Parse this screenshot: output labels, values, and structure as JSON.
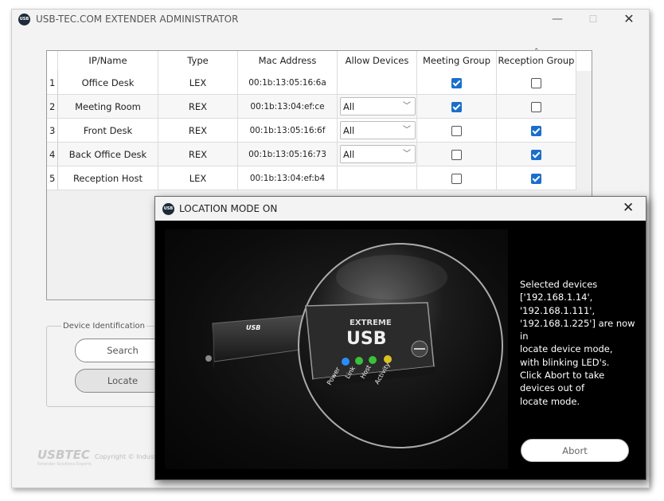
{
  "window": {
    "logo_text": "USB",
    "title": "USB-TEC.COM EXTENDER ADMINISTRATOR",
    "minimize": "—",
    "maximize": "☐",
    "close": "✕"
  },
  "table": {
    "columns": [
      "IP/Name",
      "Type",
      "Mac Address",
      "Allow Devices",
      "Meeting Group",
      "Reception Group"
    ],
    "rows": [
      {
        "num": "1",
        "name": "Office Desk",
        "type": "LEX",
        "mac": "00:1b:13:05:16:6a",
        "allow": "",
        "meeting": true,
        "reception": false
      },
      {
        "num": "2",
        "name": "Meeting Room",
        "type": "REX",
        "mac": "00:1b:13:04:ef:ce",
        "allow": "All",
        "meeting": true,
        "reception": false
      },
      {
        "num": "3",
        "name": "Front Desk",
        "type": "REX",
        "mac": "00:1b:13:05:16:6f",
        "allow": "All",
        "meeting": false,
        "reception": true
      },
      {
        "num": "4",
        "name": "Back Office Desk",
        "type": "REX",
        "mac": "00:1b:13:05:16:73",
        "allow": "All",
        "meeting": false,
        "reception": true
      },
      {
        "num": "5",
        "name": "Reception Host",
        "type": "LEX",
        "mac": "00:1b:13:04:ef:b4",
        "allow": "",
        "meeting": false,
        "reception": true
      }
    ]
  },
  "device_identification": {
    "legend": "Device Identification",
    "search_label": "Search",
    "locate_label": "Locate"
  },
  "footer": {
    "logo": "USBTEC",
    "tagline": "Extender Solutions Experts",
    "copyright": "Copyright © Industr"
  },
  "dialog": {
    "logo_text": "USB",
    "title": "LOCATION MODE ON",
    "close": "✕",
    "message": "Selected devices\n['192.168.1.14',\n'192.168.1.111',\n'192.168.1.225'] are now in\nlocate device mode,\nwith blinking LED's.\nClick Abort to take\ndevices out of\nlocate mode.",
    "abort_label": "Abort",
    "photo": {
      "brand_small": "USB",
      "brand_top": "EXTREME",
      "brand_main": "USB",
      "leds": [
        {
          "label": "Power",
          "color": "#2a8cff"
        },
        {
          "label": "Link",
          "color": "#39c23a"
        },
        {
          "label": "Host",
          "color": "#39c23a"
        },
        {
          "label": "Activity",
          "color": "#d8c421"
        }
      ]
    }
  }
}
